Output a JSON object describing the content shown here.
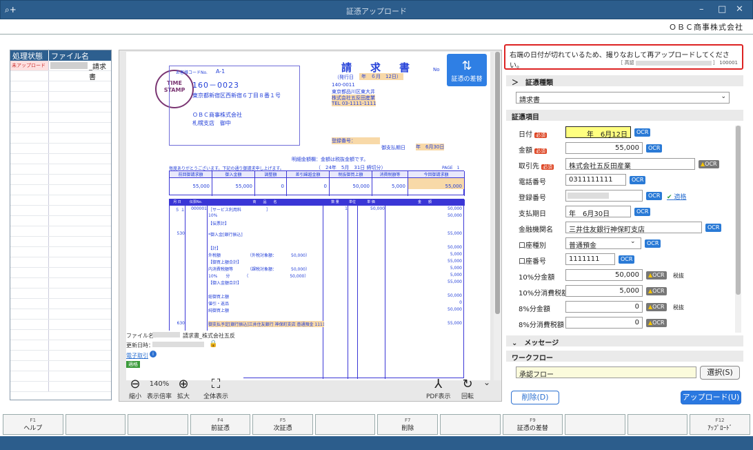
{
  "window": {
    "title": "証憑アップロード",
    "company": "ＯＢＣ商事株式会社"
  },
  "list": {
    "col_status": "処理状態",
    "col_file": "ファイル名",
    "rows": [
      {
        "status": "未アップロード",
        "file": "_請求書"
      }
    ]
  },
  "document": {
    "customer_code_label": "お客様コードNo.",
    "customer_code": "A-1",
    "postal": "160－0023",
    "address": "東京都新宿区西新宿６丁目８番１号",
    "recipient_company": "ＯＢＣ商事株式会社",
    "recipient_branch": "札幌支店　御中",
    "title": "請　求　書",
    "number_label": "No",
    "issue_label": "（発行日",
    "issue_date": "年　６月　12日）",
    "issuer_postal": "140-0011",
    "issuer_address": "東京都品川区東大井",
    "issuer_name": "株式会社五反田産業",
    "issuer_tel": "TEL 03-1111-1111",
    "reg_label": "登録番号：",
    "due_label": "御支払期日",
    "due_date": "年　6月30日",
    "note_line": "明細金額欄：金額は税抜金額です。",
    "thanks": "毎度ありがとうございます。下記の通り御請求申し上げます。",
    "close_date": "（　24年　5月　31日 締切分）",
    "page": "PAGE　1",
    "summary_headers": [
      "前回御請求額",
      "御入金額",
      "調整額",
      "差引繰越金額",
      "税抜御買上額",
      "消費税額等",
      "今回御請求額"
    ],
    "summary_values": [
      "55,000",
      "55,000",
      "0",
      "0",
      "50,000",
      "5,000",
      "55,000"
    ],
    "detail_headers": [
      "月 日",
      "伝票No.",
      "商　　品　　名",
      "数 量",
      "単位",
      "単 価",
      "金　　額"
    ],
    "detail_rows": [
      {
        "d": "５ １",
        "no": "000001",
        "name": "［サービス利用料　　　　　　］",
        "qty": "1",
        "price": "50,000",
        "amt": "50,000"
      },
      {
        "d": "",
        "no": "",
        "name": "10%",
        "qty": "",
        "price": "",
        "amt": "50,000"
      },
      {
        "d": "",
        "no": "",
        "name": "【伝票計】",
        "qty": "",
        "price": "",
        "amt": ""
      },
      {
        "d": "530",
        "no": "",
        "name": "*御入金[銀行振込]",
        "qty": "",
        "price": "",
        "amt": "55,000"
      },
      {
        "d": "",
        "no": "",
        "name": "【計】",
        "qty": "",
        "price": "",
        "amt": "50,000"
      },
      {
        "d": "",
        "no": "",
        "name": "外税額　　　　　　　（外税対象額：　　　　50,000）",
        "qty": "",
        "price": "",
        "amt": "5,000"
      },
      {
        "d": "",
        "no": "",
        "name": "【御買上額合計】",
        "qty": "",
        "price": "",
        "amt": "55,000"
      },
      {
        "d": "",
        "no": "",
        "name": "内消費税額等　　　　（課税対象額：　　　　50,000）",
        "qty": "",
        "price": "",
        "amt": "5,000"
      },
      {
        "d": "",
        "no": "",
        "name": "10%　　分　　　　（　　　　　　　　　　50,000）",
        "qty": "",
        "price": "",
        "amt": "5,000"
      },
      {
        "d": "",
        "no": "",
        "name": "【御入金額合計】",
        "qty": "",
        "price": "",
        "amt": "55,000"
      },
      {
        "d": "",
        "no": "",
        "name": "総御買上額",
        "qty": "",
        "price": "",
        "amt": "50,000"
      },
      {
        "d": "",
        "no": "",
        "name": "値引・返品",
        "qty": "",
        "price": "",
        "amt": "0"
      },
      {
        "d": "",
        "no": "",
        "name": "純御買上額",
        "qty": "",
        "price": "",
        "amt": "50,000"
      },
      {
        "d": "630",
        "no": "",
        "name": "御支払予定[銀行振込]三井住友銀行 神保町支店 普通預金 1111111",
        "qty": "",
        "price": "",
        "amt": "55,000"
      }
    ]
  },
  "fileinfo": {
    "name_label": "ファイル名：",
    "name_value": "請求書_株式会社五反",
    "updated_label": "更新日時：",
    "edoc_link": "電子取引",
    "badge": "適格"
  },
  "viewer": {
    "zoom": "140%",
    "zoom_out": "縮小",
    "zoom_label": "表示倍率",
    "zoom_in": "拡大",
    "fit": "全体表示",
    "pdf": "PDF表示",
    "rotate": "回転",
    "diff_btn": "証憑の差替"
  },
  "warning": {
    "text": "右端の日付が切れているため、撮りなおして再アップロードしてください。",
    "code_label": "［ 高認",
    "code": "］ 100001"
  },
  "voucher_type": {
    "header": "証憑種類",
    "value": "請求書"
  },
  "fields_header": "証憑項目",
  "required": "必須",
  "ocr": "OCR",
  "tax_excl": "税抜",
  "fields": [
    {
      "label": "日付",
      "value": "年　6月12日",
      "req": true
    },
    {
      "label": "金額",
      "value": "55,000",
      "req": true
    },
    {
      "label": "取引先",
      "value": "株式会社五反田産業",
      "req": true
    },
    {
      "label": "電話番号",
      "value": "0311111111",
      "req": false
    },
    {
      "label": "登録番号",
      "value": "",
      "req": false,
      "extra": "適格"
    },
    {
      "label": "支払期日",
      "value": "年　6月30日",
      "req": false
    },
    {
      "label": "金融機関名",
      "value": "三井住友銀行神保町支店",
      "req": false
    },
    {
      "label": "口座種別",
      "value": "普通預金",
      "req": false
    },
    {
      "label": "口座番号",
      "value": "1111111",
      "req": false
    },
    {
      "label": "10%分金額",
      "value": "50,000",
      "req": false
    },
    {
      "label": "10%分消費税額",
      "value": "5,000",
      "req": false
    },
    {
      "label": "8%分金額",
      "value": "0",
      "req": false
    },
    {
      "label": "8%分消費税額",
      "value": "0",
      "req": false
    }
  ],
  "message_header": "メッセージ",
  "workflow": {
    "header": "ワークフロー",
    "value": "承認フロー",
    "select_btn": "選択(S)"
  },
  "buttons": {
    "delete": "削除(D)",
    "upload": "アップロード(U)"
  },
  "fkeys": [
    {
      "k": "F1",
      "l": "ヘルプ"
    },
    {
      "k": "",
      "l": ""
    },
    {
      "k": "",
      "l": ""
    },
    {
      "k": "F4",
      "l": "前証憑"
    },
    {
      "k": "F5",
      "l": "次証憑"
    },
    {
      "k": "",
      "l": ""
    },
    {
      "k": "F7",
      "l": "削除"
    },
    {
      "k": "",
      "l": ""
    },
    {
      "k": "F9",
      "l": "証憑の差替"
    },
    {
      "k": "",
      "l": ""
    },
    {
      "k": "",
      "l": ""
    },
    {
      "k": "F12",
      "l": "ｱｯﾌﾟﾛｰﾄﾞ"
    }
  ]
}
